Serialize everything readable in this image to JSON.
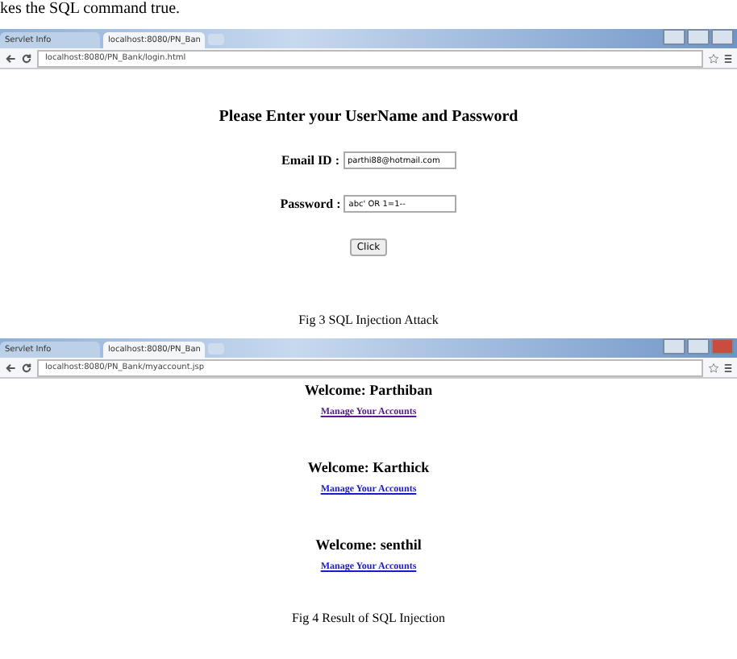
{
  "intro_text": "kes the SQL command true.",
  "figures": [
    {
      "browser": {
        "tabs": [
          {
            "label": "Servlet Info",
            "selected": false
          },
          {
            "label": "localhost:8080/PN_Ban",
            "selected": true
          }
        ],
        "address": "localhost:8080/PN_Bank/login.html"
      },
      "kind": "login",
      "heading": "Please Enter your UserName and Password",
      "fields": [
        {
          "label": "Email ID :",
          "value": "parthi88@hotmail.com"
        },
        {
          "label": "Password :",
          "value": "abc' OR 1=1--"
        }
      ],
      "button": "Click",
      "caption": "Fig 3 SQL Injection Attack"
    },
    {
      "browser": {
        "tabs": [
          {
            "label": "Servlet Info",
            "selected": false
          },
          {
            "label": "localhost:8080/PN_Ban",
            "selected": true
          }
        ],
        "address": "localhost:8080/PN_Bank/myaccount.jsp"
      },
      "kind": "result",
      "accounts": [
        {
          "welcome": "Welcome: Parthiban",
          "link": "Manage Your Accounts",
          "visited": true
        },
        {
          "welcome": "Welcome: Karthick",
          "link": "Manage Your Accounts",
          "visited": false
        },
        {
          "welcome": "Welcome: senthil",
          "link": "Manage Your Accounts",
          "visited": false
        }
      ],
      "caption": "Fig 4 Result of SQL Injection"
    }
  ]
}
